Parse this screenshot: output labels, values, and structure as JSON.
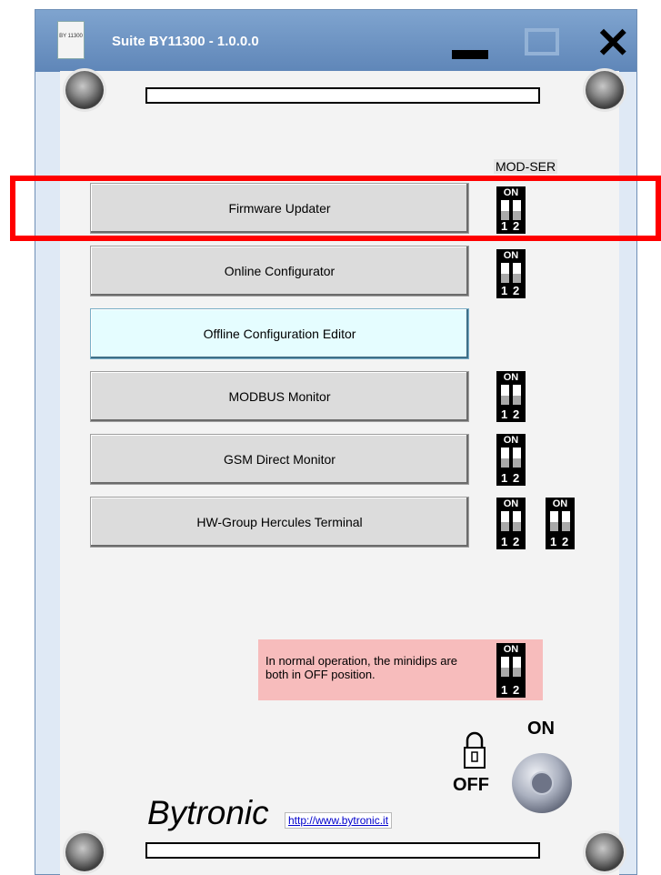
{
  "window": {
    "title": "Suite BY11300 - 1.0.0.0",
    "icon_text": "BY 11300"
  },
  "dip_labels": {
    "on": "ON",
    "one": "1",
    "two": "2"
  },
  "modser_label": "MOD-SER",
  "buttons": [
    {
      "label": "Firmware Updater"
    },
    {
      "label": "Online Configurator"
    },
    {
      "label": "Offline Configuration Editor"
    },
    {
      "label": "MODBUS Monitor"
    },
    {
      "label": "GSM Direct Monitor"
    },
    {
      "label": "HW-Group Hercules Terminal"
    }
  ],
  "note": {
    "text": "In normal operation, the minidips are both in OFF position."
  },
  "key_switch": {
    "on_label": "ON",
    "off_label": "OFF"
  },
  "brand": {
    "logo": "Bytronic",
    "url": "http://www.bytronic.it"
  },
  "colors": {
    "highlight": "#ff0000",
    "note_bg": "#f7bcbc",
    "cyan_button": "#e5fdff"
  }
}
